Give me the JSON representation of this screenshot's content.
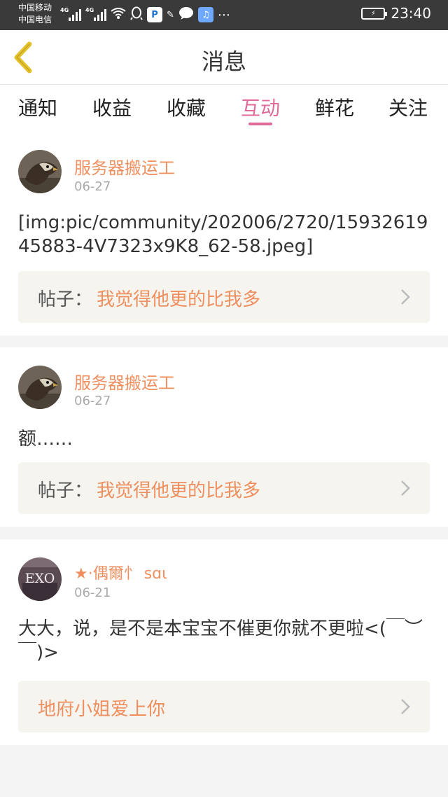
{
  "status_bar": {
    "carrier1": "中国移动",
    "carrier2": "中国电信",
    "net1": "4G",
    "net2": "4G",
    "time": "23:40"
  },
  "header": {
    "title": "消息",
    "back_icon": "chevron-left-icon"
  },
  "tabs": [
    {
      "label": "通知"
    },
    {
      "label": "收益"
    },
    {
      "label": "收藏"
    },
    {
      "label": "互动",
      "active": true
    },
    {
      "label": "鲜花"
    },
    {
      "label": "关注"
    }
  ],
  "messages": [
    {
      "user": "服务器搬运工",
      "date": "06-27",
      "content": "[img:pic/community/202006/2720/1593261945883-4V7323x9K8_62-58.jpeg]",
      "post_label": "帖子：",
      "post_title": "我觉得他更的比我多"
    },
    {
      "user": "服务器搬运工",
      "date": "06-27",
      "content": "额……",
      "post_label": "帖子：",
      "post_title": "我觉得他更的比我多"
    },
    {
      "user": "★·偶爾忄 sɑι",
      "date": "06-21",
      "content": "大大，说，是不是本宝宝不催更你就不更啦<(￣︶￣)>",
      "post_title": "地府小姐爱上你"
    }
  ],
  "avatar3_text": "EXO",
  "colors": {
    "accent_pink": "#e06a9a",
    "name_orange": "#ef8f5f",
    "back_yellow": "#e5c22a"
  }
}
